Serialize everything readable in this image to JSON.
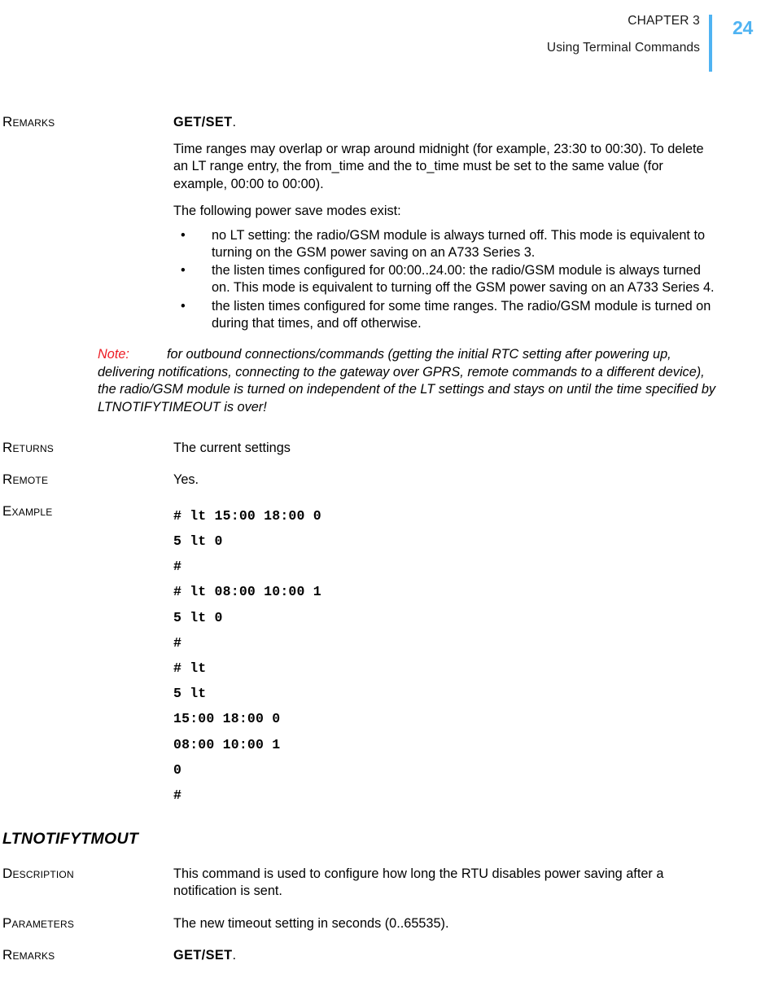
{
  "header": {
    "chapter": "CHAPTER 3",
    "subtitle": "Using Terminal Commands",
    "page_number": "24",
    "rule_color": "#4FB3F2",
    "page_number_color": "#4FB3F2"
  },
  "sections": [
    {
      "label": "Remarks",
      "command": "GET/SET",
      "command_suffix": ".",
      "paragraphs": [
        "Time ranges may overlap or wrap around midnight (for example, 23:30 to 00:30). To delete an LT range entry, the from_time and the to_time must be set to the same value (for example, 00:00 to 00:00).",
        "The following power save modes exist:"
      ],
      "bullets": [
        "no LT setting: the radio/GSM module is always turned off. This mode is equivalent to turning on the GSM power saving on an A733 Series 3.",
        "the listen times configured for 00:00..24.00: the radio/GSM module is always turned on. This mode is equivalent to turning off the GSM power saving on an A733 Series 4.",
        "the listen times configured for some time ranges. The radio/GSM module is turned on during that times, and off otherwise."
      ],
      "bullet_marker": "•",
      "note": {
        "label": "Note:",
        "label_color": "#ED1C24",
        "text": "for outbound connections/commands (getting the initial RTC setting after powering up, delivering notifications, connecting to the gateway over GPRS, remote commands to a different device), the radio/GSM module is turned on independent of the LT settings and stays on until the time specified by LTNOTIFYTIMEOUT is over!"
      }
    },
    {
      "label": "Returns",
      "text": "The current settings"
    },
    {
      "label": "Remote",
      "text": "Yes."
    },
    {
      "label": "Example",
      "mono_lines": [
        "# lt 15:00 18:00 0",
        "5 lt 0",
        "#",
        "# lt 08:00 10:00 1",
        "5 lt 0",
        "#",
        "# lt",
        "5 lt",
        "15:00 18:00 0",
        "08:00 10:00 1",
        "0",
        "#"
      ]
    }
  ],
  "command_section": {
    "heading": "LTNOTIFYTMOUT",
    "rows": [
      {
        "label": "Description",
        "text": "This command is used to configure how long the RTU disables power saving after a notification is sent."
      },
      {
        "label": "Parameters",
        "text": "The new timeout setting in seconds (0..65535)."
      }
    ],
    "remarks": {
      "label": "Remarks",
      "command": "GET/SET",
      "command_suffix": "."
    }
  }
}
